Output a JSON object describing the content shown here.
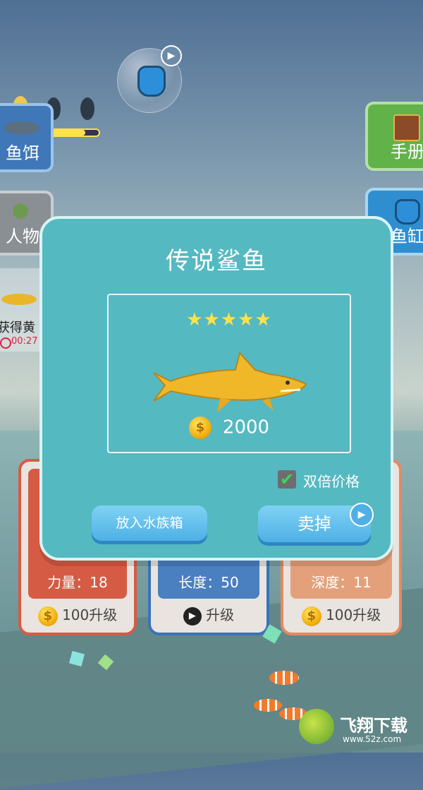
{
  "sidebar_left": {
    "bait": {
      "label": "鱼饵"
    },
    "character": {
      "label": "人物"
    },
    "catch_notice": {
      "text": "获得黄",
      "timer": "00:27"
    }
  },
  "sidebar_right": {
    "handbook": {
      "label": "手册"
    },
    "fish_tank": {
      "label": "鱼缸"
    }
  },
  "modal": {
    "title": "传说鲨鱼",
    "stars": "★★★★★",
    "price": "2000",
    "double_price_label": "双倍价格",
    "double_price_checked": true,
    "put_in_aquarium_label": "放入水族箱",
    "sell_label": "卖掉"
  },
  "cards": [
    {
      "stat": "力量：18",
      "footer": "100升级"
    },
    {
      "stat": "长度：50",
      "footer": "升级"
    },
    {
      "stat": "深度：11",
      "footer": "100升级"
    }
  ],
  "watermark": {
    "brand": "飞翔下载",
    "url": "www.52z.com"
  },
  "colors": {
    "modal_bg": "#55b9c1",
    "button_blue": "#4fb0e6",
    "star": "#ffe14a",
    "bait_btn": "#3f77b9",
    "handbook_btn": "#62b24a"
  }
}
